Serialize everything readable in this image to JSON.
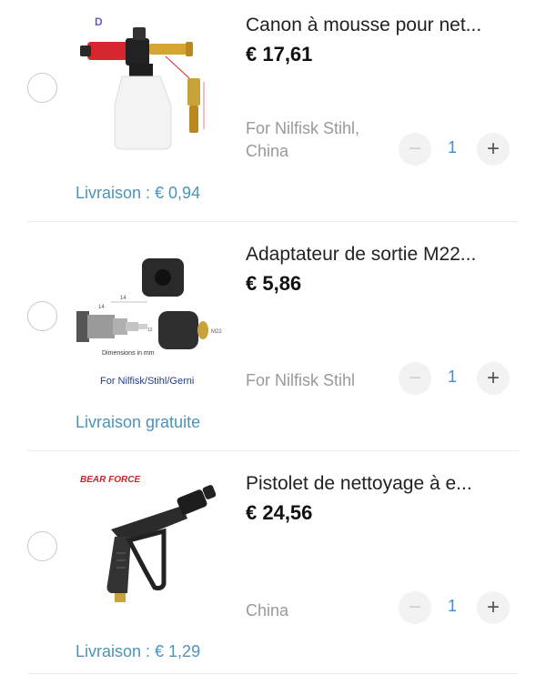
{
  "items": [
    {
      "title": "Canon à mousse pour net...",
      "price": "€ 17,61",
      "variant": "For Nilfisk Stihl, China",
      "quantity": "1",
      "shipping": "Livraison : € 0,94",
      "image_icon": "foam-cannon-image"
    },
    {
      "title": "Adaptateur de sortie M22...",
      "price": "€ 5,86",
      "variant": "For Nilfisk Stihl",
      "quantity": "1",
      "shipping": "Livraison gratuite",
      "image_icon": "m22-adapter-image",
      "image_text": {
        "brand_caption": "For Nilfisk/Stihl/Gerni",
        "dimensions": "Dimensions in mm",
        "label_m22": "M22",
        "label_14a": "14",
        "label_14b": "14",
        "label_12": "12"
      }
    },
    {
      "title": "Pistolet de nettoyage à e...",
      "price": "€ 24,56",
      "variant": "China",
      "quantity": "1",
      "shipping": "Livraison : € 1,29",
      "image_icon": "spray-gun-image",
      "image_text": {
        "logo": "BEAR FORCE"
      }
    }
  ],
  "controls": {
    "minus_symbol": "−",
    "plus_symbol": "+"
  },
  "colors": {
    "shipping": "#4a95b8",
    "quantity": "#3b8fd6",
    "muted": "#999999"
  }
}
